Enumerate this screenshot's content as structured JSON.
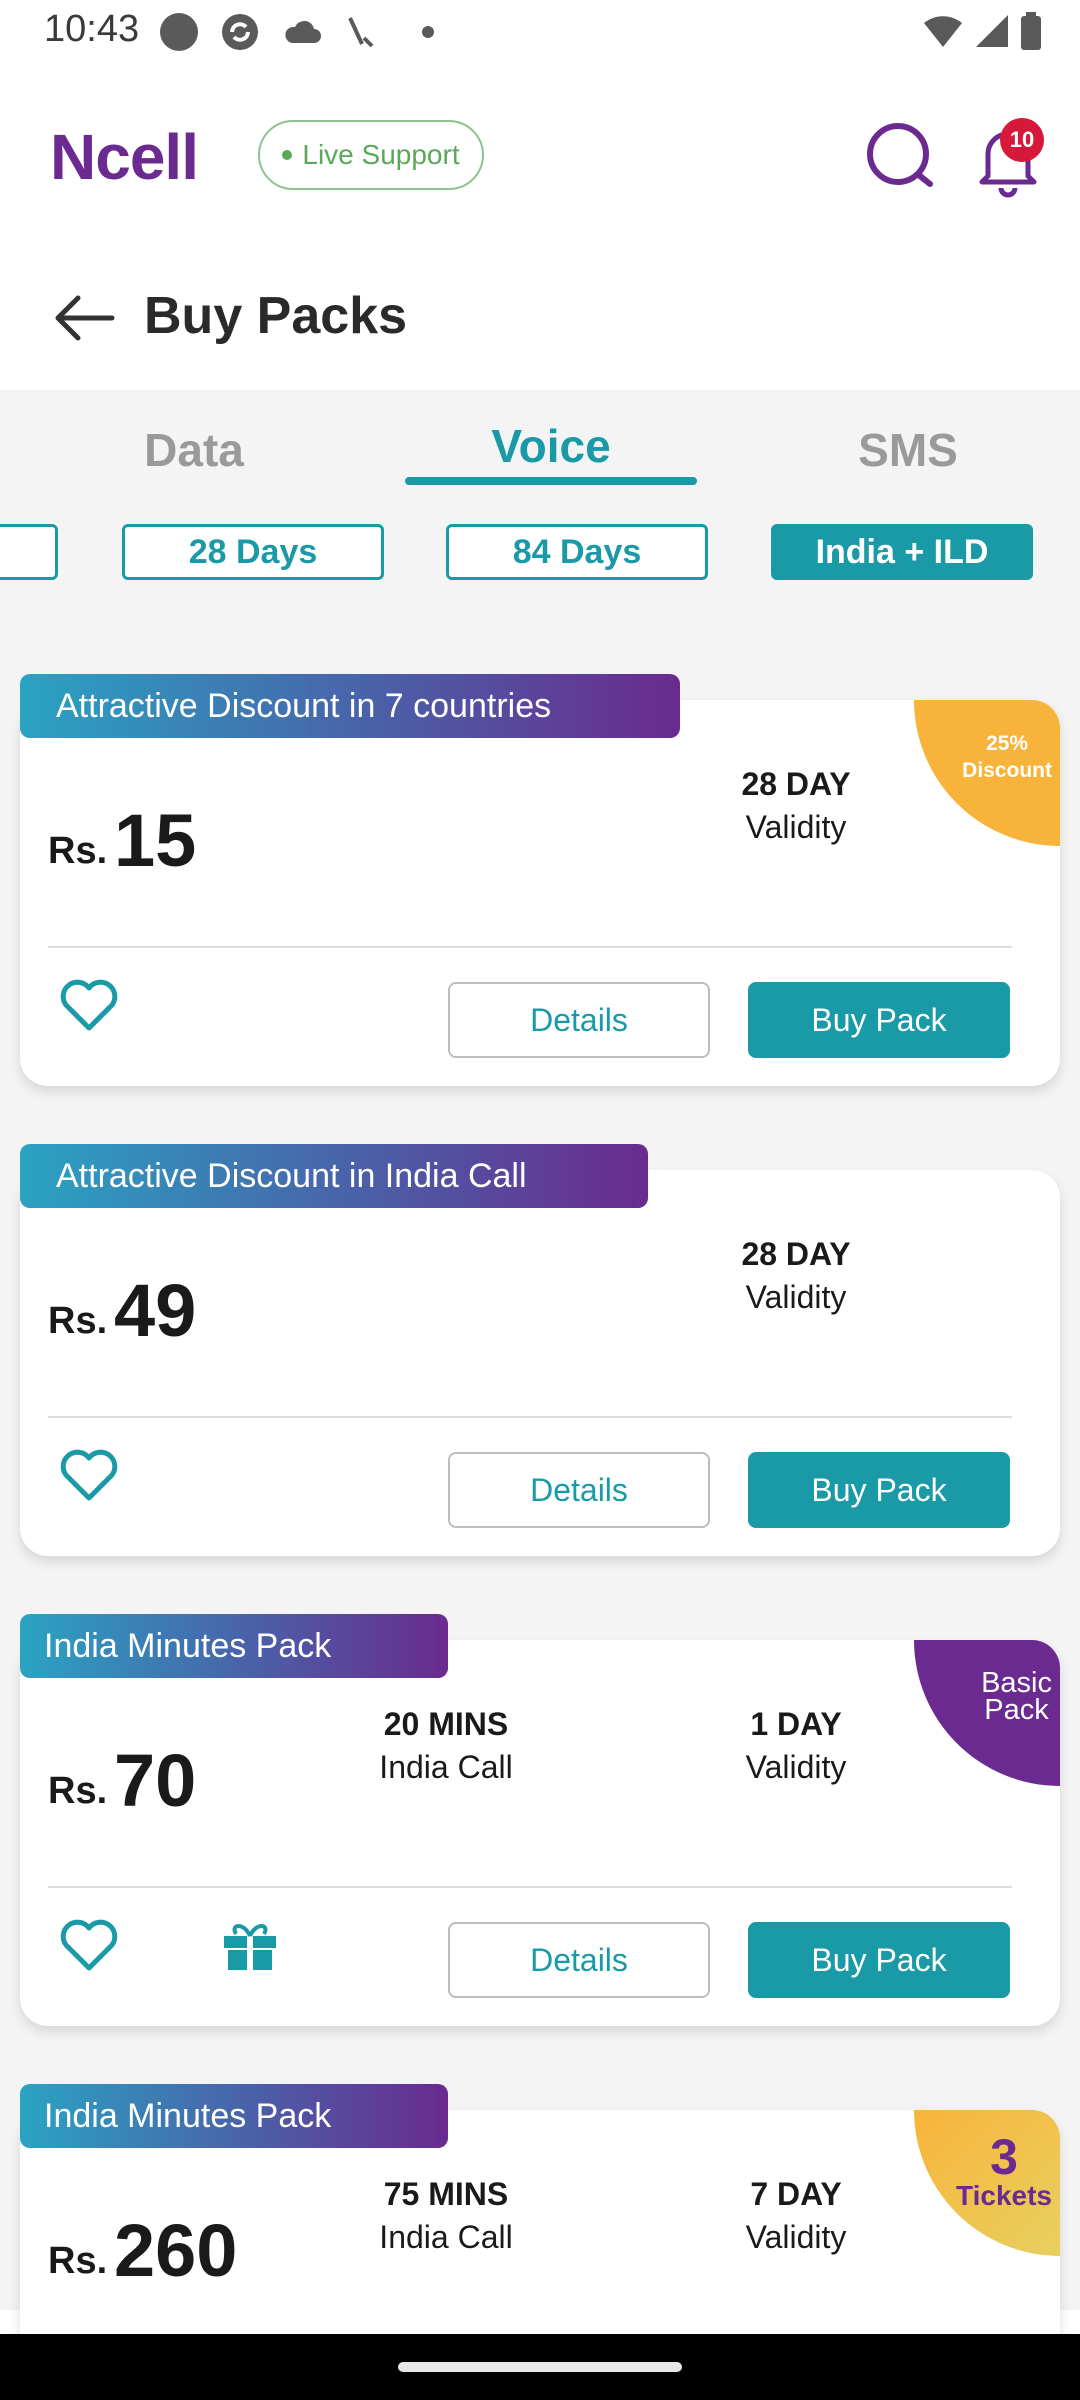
{
  "status_bar": {
    "time": "10:43"
  },
  "header": {
    "logo": "Ncell",
    "live_support": "Live Support",
    "notification_count": "10"
  },
  "page": {
    "title": "Buy Packs"
  },
  "tabs": [
    {
      "label": "Data",
      "active": false
    },
    {
      "label": "Voice",
      "active": true
    },
    {
      "label": "SMS",
      "active": false
    }
  ],
  "filters": [
    {
      "label": "28 Days",
      "selected": false
    },
    {
      "label": "84 Days",
      "selected": false
    },
    {
      "label": "India + ILD",
      "selected": true
    }
  ],
  "packs": [
    {
      "banner": "Attractive Discount in 7 countries",
      "corner": {
        "line1": "25%",
        "line2": "Discount"
      },
      "currency": "Rs.",
      "price": "15",
      "validity_main": "28 DAY",
      "validity_sub": "Validity",
      "details": "Details",
      "buy": "Buy Pack"
    },
    {
      "banner": "Attractive Discount in India Call",
      "currency": "Rs.",
      "price": "49",
      "validity_main": "28 DAY",
      "validity_sub": "Validity",
      "details": "Details",
      "buy": "Buy Pack"
    },
    {
      "banner": "India Minutes Pack",
      "corner": {
        "line1": "Basic",
        "line2": "Pack"
      },
      "currency": "Rs.",
      "price": "70",
      "minutes_main": "20 MINS",
      "minutes_sub": "India Call",
      "validity_main": "1 DAY",
      "validity_sub": "Validity",
      "details": "Details",
      "buy": "Buy Pack"
    },
    {
      "banner": "India Minutes Pack",
      "corner": {
        "line1": "3",
        "line2": "Tickets"
      },
      "currency": "Rs.",
      "price": "260",
      "minutes_main": "75 MINS",
      "minutes_sub": "India Call",
      "validity_main": "7 DAY",
      "validity_sub": "Validity"
    }
  ],
  "colors": {
    "brand_purple": "#6a2a8f",
    "accent_teal": "#1a9aa6",
    "discount_orange": "#f8b43a",
    "badge_red": "#d6183b"
  }
}
